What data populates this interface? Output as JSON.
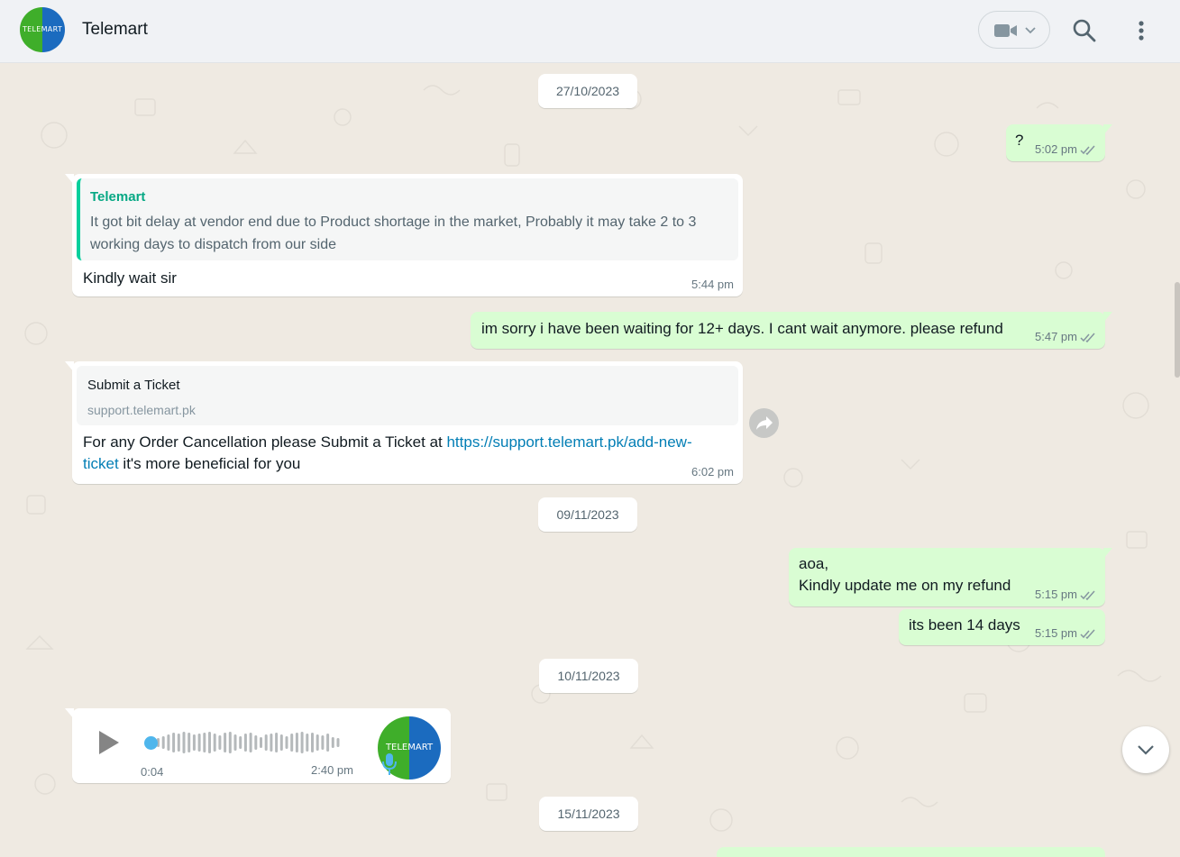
{
  "header": {
    "contact_name": "Telemart",
    "avatar_text": "TELEMART",
    "icons": [
      "video-camera-icon",
      "chevron-down-icon",
      "search-icon",
      "menu-dots-icon"
    ]
  },
  "colors": {
    "outgoing_bubble": "#d9fdd3",
    "incoming_bubble": "#ffffff",
    "chat_background": "#efeae2",
    "quote_accent": "#06cf9c",
    "link": "#027eb5",
    "voice_progress": "#4fb6ec"
  },
  "dates": [
    "27/10/2023",
    "09/11/2023",
    "10/11/2023",
    "15/11/2023"
  ],
  "messages": {
    "m1": {
      "text": "?",
      "time": "5:02 pm"
    },
    "m2": {
      "quote_author": "Telemart",
      "quote_text": "It got bit delay at vendor end due to Product shortage in the market, Probably it may take 2 to 3 working days to dispatch from our side",
      "text": "Kindly wait sir",
      "time": "5:44 pm"
    },
    "m3": {
      "text": "im sorry i have been waiting for 12+ days. I cant wait anymore. please refund",
      "time": "5:47 pm"
    },
    "m4": {
      "preview_title": "Submit a Ticket",
      "preview_domain": "support.telemart.pk",
      "text_before": "For any Order Cancellation please Submit a Ticket at ",
      "link_part1": "https://support.telemart.pk/add-new-",
      "link_part2": "ticket",
      "text_after": " it's more beneficial for you",
      "time": "6:02 pm"
    },
    "m5": {
      "line1": "aoa,",
      "line2": "Kindly update me on my refund",
      "time": "5:15 pm"
    },
    "m6": {
      "text": "its been 14 days",
      "time": "5:15 pm"
    },
    "m7": {
      "duration": "0:04",
      "time": "2:40 pm",
      "avatar_text": "TELEMART",
      "progress": 0
    }
  }
}
